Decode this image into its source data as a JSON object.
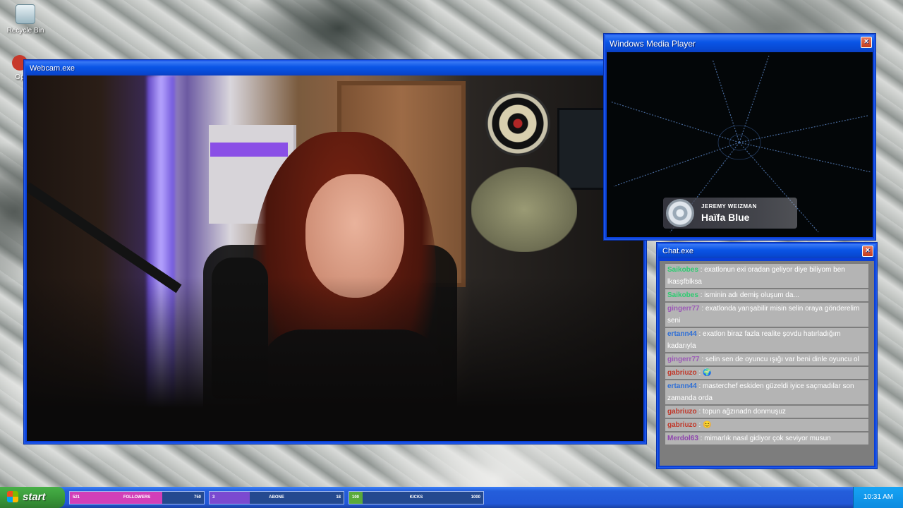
{
  "desktop": {
    "icons": [
      {
        "label": "Recycle Bin",
        "icon": "recycle-bin-icon"
      },
      {
        "label": "Op",
        "icon": "app-icon"
      }
    ]
  },
  "webcam_window": {
    "title": "Webcam.exe"
  },
  "media_player": {
    "title": "Windows Media Player",
    "now_playing": {
      "artist": "JEREMY WEIZMAN",
      "track": "Haïfa Blue"
    }
  },
  "chat_window": {
    "title": "Chat.exe",
    "messages": [
      {
        "user": "Saikobes",
        "user_color": "#2ecc71",
        "text": "exatlonun exi oradan geliyor diye biliyom ben lkasşfblksa"
      },
      {
        "user": "Saikobes",
        "user_color": "#2ecc71",
        "text": "isminin adı demiş oluşum da..."
      },
      {
        "user": "gingerr77",
        "user_color": "#9b59b6",
        "text": "exatlonda yarışabilir misin selin oraya gönderelim seni"
      },
      {
        "user": "ertann44",
        "user_color": "#2f6fd6",
        "text": "exatlon biraz fazla realite şovdu hatırladığım kadarıyla"
      },
      {
        "user": "gingerr77",
        "user_color": "#9b59b6",
        "text": "selin sen de oyuncu ışığı var beni dinle oyuncu ol"
      },
      {
        "user": "gabriuzo",
        "user_color": "#c0392b",
        "text": "🌍"
      },
      {
        "user": "ertann44",
        "user_color": "#2f6fd6",
        "text": "masterchef eskiden güzeldi iyice saçmadılar son zamanda orda"
      },
      {
        "user": "gabriuzo",
        "user_color": "#c0392b",
        "text": "topun ağzınadn donmuşuz"
      },
      {
        "user": "gabriuzo",
        "user_color": "#c0392b",
        "text": "😊"
      },
      {
        "user": "Merdol63",
        "user_color": "#8e44ad",
        "text": "mimarlık nasıl gidiyor çok seviyor musun"
      }
    ]
  },
  "taskbar": {
    "start_label": "start",
    "stats": [
      {
        "left": "521",
        "label": "FOLLOWERS",
        "right": "750",
        "fill_color": "#d23fb8",
        "fill_fraction": 0.69
      },
      {
        "left": "3",
        "label": "ABONE",
        "right": "18",
        "fill_color": "#7b4ad0",
        "fill_fraction": 0.3
      },
      {
        "left": "100",
        "label": "KICKS",
        "right": "1000",
        "fill_color": "#5aaa3a",
        "fill_fraction": 0.1
      }
    ],
    "clock": "10:31 AM"
  }
}
